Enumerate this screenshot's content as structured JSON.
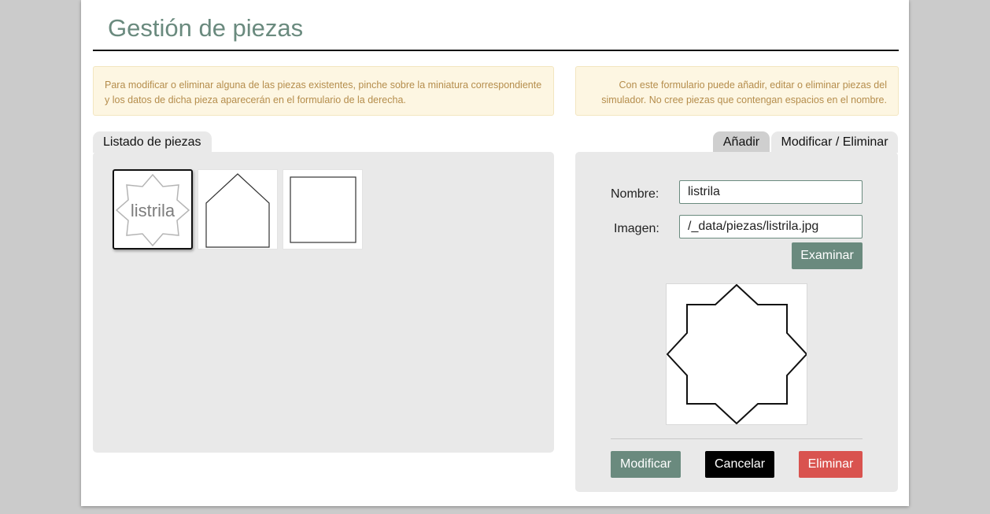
{
  "header": {
    "title": "Gestión de piezas"
  },
  "notices": {
    "left": "Para modificar o eliminar alguna de las piezas existentes, pinche sobre la miniatura correspondiente y los datos de dicha pieza aparecerán en el formulario de la derecha.",
    "right": "Con este formulario puede añadir, editar o eliminar piezas del simulador. No cree piezas que contengan espacios en el nombre."
  },
  "list": {
    "tab_label": "Listado de piezas",
    "thumbnails": [
      {
        "label": "listrila",
        "shape": "eight-point-star",
        "selected": true
      },
      {
        "label": "",
        "shape": "house-pentagon",
        "selected": false
      },
      {
        "label": "",
        "shape": "square",
        "selected": false
      }
    ]
  },
  "form": {
    "tabs": [
      {
        "label": "Añadir",
        "active": false
      },
      {
        "label": "Modificar / Eliminar",
        "active": true
      }
    ],
    "nombre_label": "Nombre:",
    "nombre_value": "listrila",
    "imagen_label": "Imagen:",
    "imagen_value": "/_data/piezas/listrila.jpg",
    "browse_label": "Examinar",
    "preview_shape": "eight-point-star",
    "buttons": {
      "modify": "Modificar",
      "cancel": "Cancelar",
      "delete": "Eliminar"
    }
  },
  "colors": {
    "accent": "#6a8a7e",
    "danger": "#d9534f",
    "notice_bg": "#fdf6e2",
    "notice_text": "#b58d4c"
  }
}
